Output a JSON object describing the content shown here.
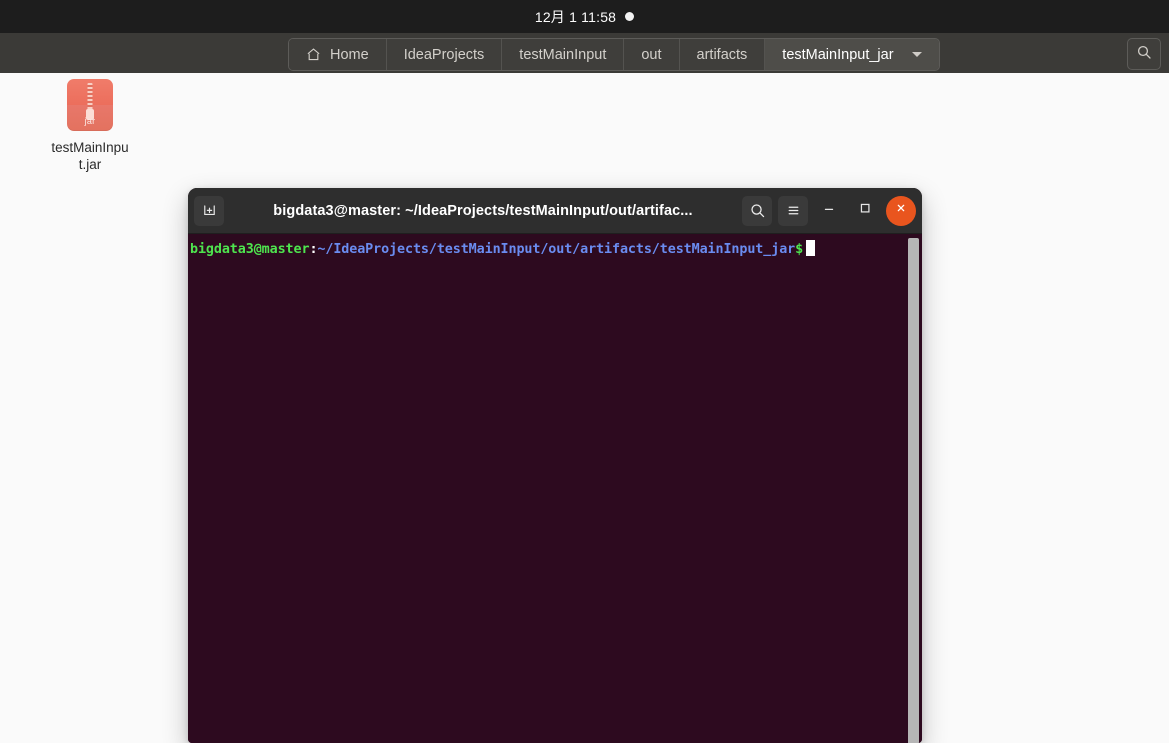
{
  "top_panel": {
    "clock": "12月 1  11:58",
    "indicator": "notification-dot"
  },
  "pathbar": {
    "crumbs": [
      {
        "label": "Home",
        "icon": "home-icon",
        "active": false
      },
      {
        "label": "IdeaProjects",
        "active": false
      },
      {
        "label": "testMainInput",
        "active": false
      },
      {
        "label": "out",
        "active": false
      },
      {
        "label": "artifacts",
        "active": false
      },
      {
        "label": "testMainInput_jar",
        "active": true,
        "has_dropdown": true
      }
    ],
    "search_icon": "search-icon"
  },
  "desktop": {
    "icons": [
      {
        "name": "testMainInput.jar",
        "type": "jar-archive",
        "badge": "jar"
      }
    ],
    "background_color": "#fafafa"
  },
  "terminal": {
    "title": "bigdata3@master: ~/IdeaProjects/testMainInput/out/artifac...",
    "new_tab_icon": "new-tab-icon",
    "search_icon": "search-icon",
    "menu_icon": "hamburger-menu-icon",
    "minimize_label": "—",
    "maximize_label": "□",
    "close_label": "✕",
    "prompt": {
      "user_host": "bigdata3@master",
      "separator": ":",
      "path": "~/IdeaProjects/testMainInput/out/artifacts/testMainInput_jar",
      "sigil": "$"
    },
    "colors": {
      "background": "#2d0a1f",
      "user_host": "#4ee44e",
      "path": "#6a8cf0",
      "close_button": "#e9551e"
    }
  }
}
